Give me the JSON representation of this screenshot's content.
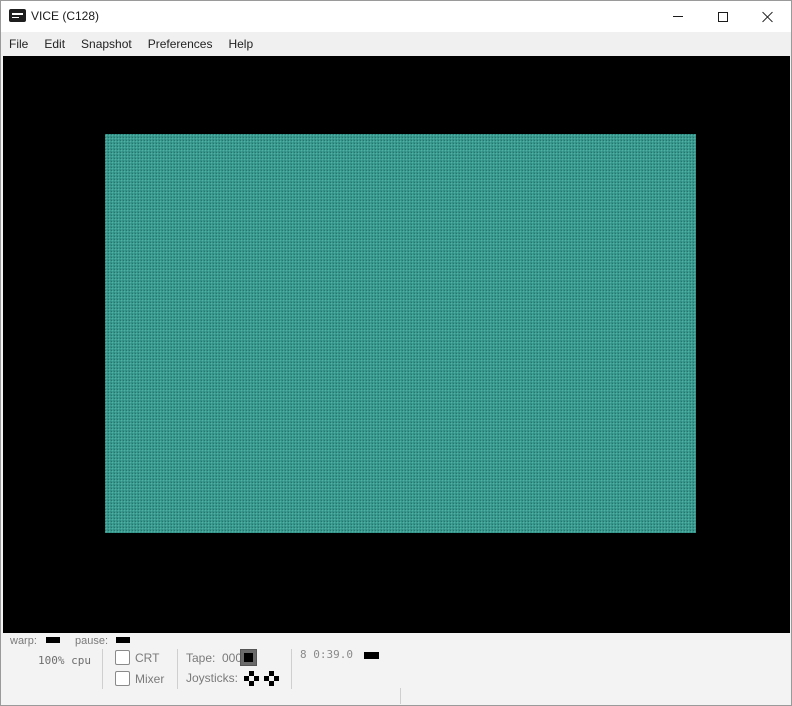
{
  "window": {
    "title": "VICE (C128)",
    "app_icon": "vice-monitor-icon",
    "controls": [
      "minimize-icon",
      "maximize-icon",
      "close-icon"
    ]
  },
  "menu": {
    "items": [
      {
        "label": "File"
      },
      {
        "label": "Edit"
      },
      {
        "label": "Snapshot"
      },
      {
        "label": "Preferences"
      },
      {
        "label": "Help"
      }
    ]
  },
  "display": {
    "border_color": "#000000",
    "screen_color": "#2f8b82"
  },
  "statusbar": {
    "warp_label": "warp:",
    "pause_label": "pause:",
    "speed": "100% cpu",
    "crt_label": "CRT",
    "mixer_label": "Mixer",
    "tape_label": "Tape:",
    "tape_counter": "000",
    "joysticks_label": "Joysticks:",
    "drive_info": "8 0:39.0"
  }
}
